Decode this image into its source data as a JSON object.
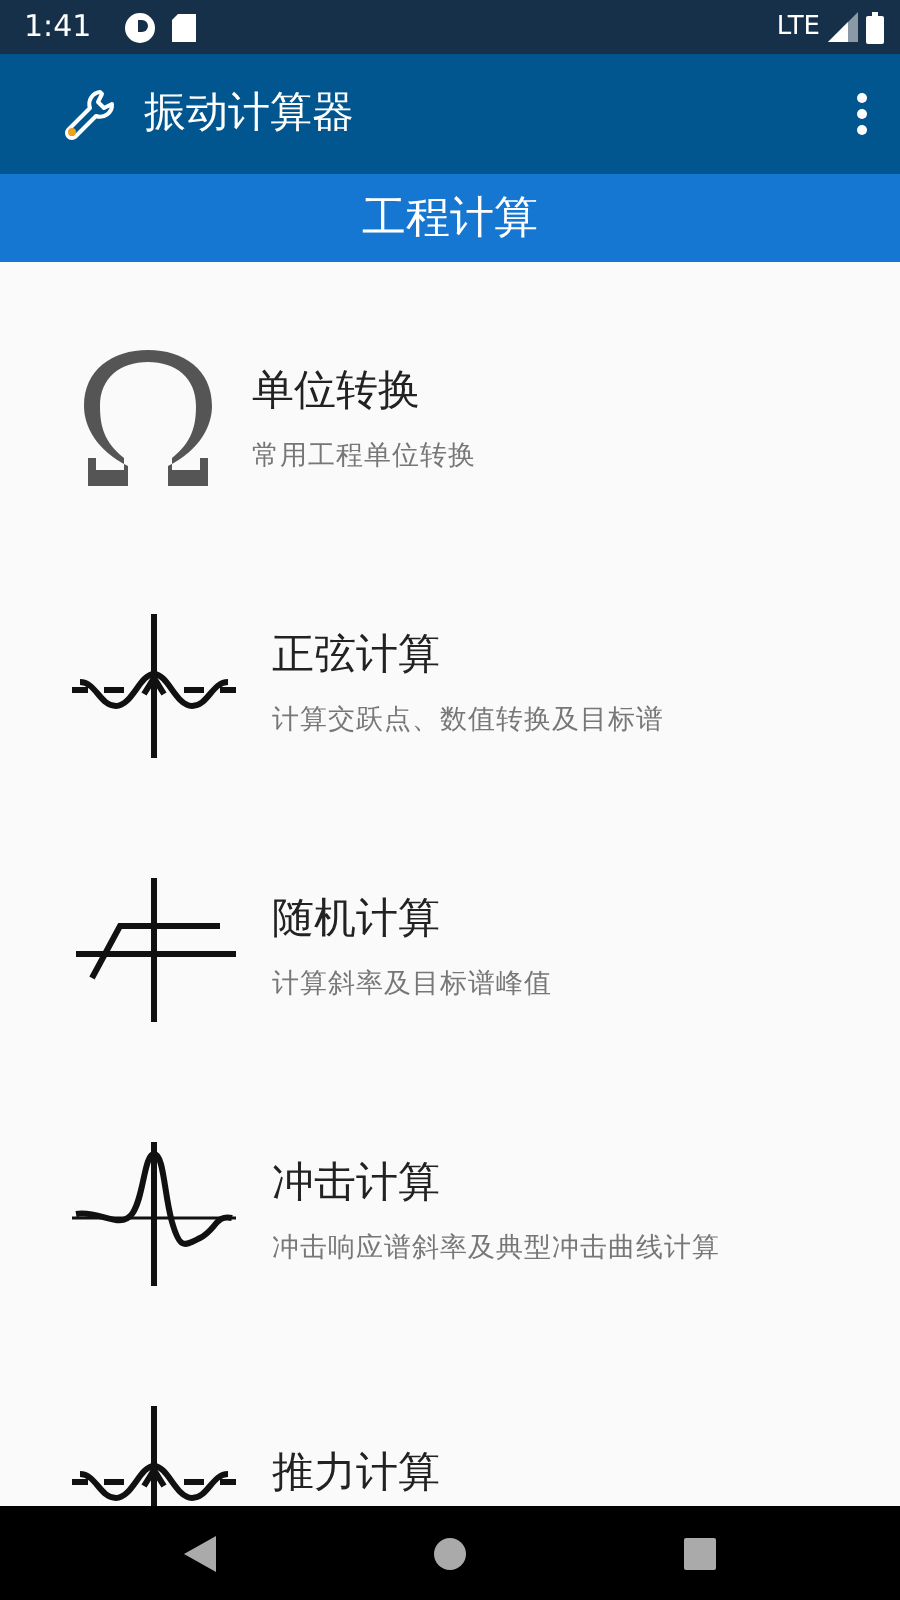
{
  "status_bar": {
    "time": "1:41",
    "network": "LTE"
  },
  "app_bar": {
    "title": "振动计算器"
  },
  "section_header": {
    "title": "工程计算"
  },
  "items": [
    {
      "kind": "omega",
      "title": "单位转换",
      "subtitle": "常用工程单位转换"
    },
    {
      "kind": "sine",
      "title": "正弦计算",
      "subtitle": "计算交跃点、数值转换及目标谱"
    },
    {
      "kind": "random",
      "title": "随机计算",
      "subtitle": "计算斜率及目标谱峰值"
    },
    {
      "kind": "shock",
      "title": "冲击计算",
      "subtitle": "冲击响应谱斜率及典型冲击曲线计算"
    },
    {
      "kind": "sine",
      "title": "推力计算"
    }
  ]
}
